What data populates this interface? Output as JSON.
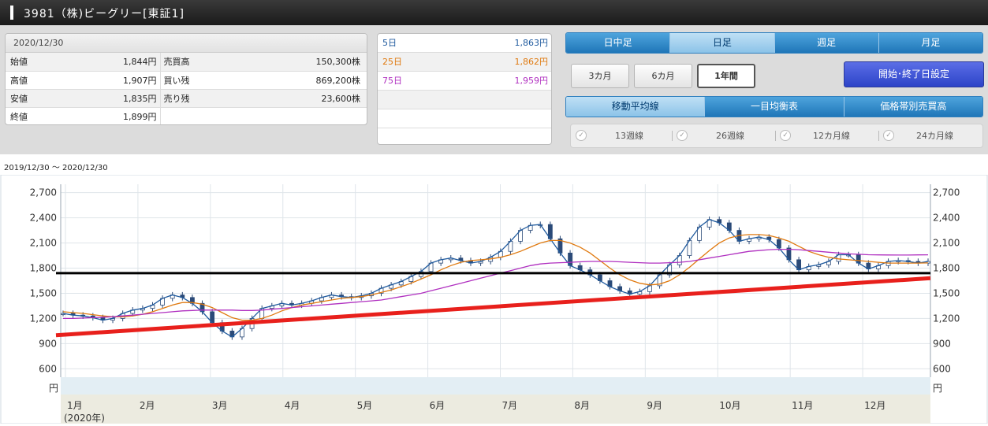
{
  "header": {
    "title": "3981（株)ビーグリー[東証1]"
  },
  "quote": {
    "date": "2020/12/30",
    "rows": [
      {
        "l1": "始値",
        "v1": "1,844円",
        "l2": "売買高",
        "v2": "150,300株"
      },
      {
        "l1": "高値",
        "v1": "1,907円",
        "l2": "買い残",
        "v2": "869,200株"
      },
      {
        "l1": "安値",
        "v1": "1,835円",
        "l2": "売り残",
        "v2": "23,600株"
      },
      {
        "l1": "終値",
        "v1": "1,899円",
        "l2": "",
        "v2": ""
      }
    ]
  },
  "moving_averages": [
    {
      "label": "5日",
      "value": "1,863円",
      "color": "#1f5a9e"
    },
    {
      "label": "25日",
      "value": "1,862円",
      "color": "#e07a10"
    },
    {
      "label": "75日",
      "value": "1,959円",
      "color": "#b030c0"
    }
  ],
  "timeframe_tabs": [
    {
      "label": "日中足",
      "active": false
    },
    {
      "label": "日足",
      "active": true
    },
    {
      "label": "週足",
      "active": false
    },
    {
      "label": "月足",
      "active": false
    }
  ],
  "period_buttons": [
    {
      "label": "3カ月",
      "active": false
    },
    {
      "label": "6カ月",
      "active": false
    },
    {
      "label": "1年間",
      "active": true
    }
  ],
  "range_button": "開始･終了日設定",
  "indicator_tabs": [
    {
      "label": "移動平均線",
      "active": true
    },
    {
      "label": "一目均衡表",
      "active": false
    },
    {
      "label": "価格帯別売買高",
      "active": false
    }
  ],
  "week_options": [
    "13週線",
    "26週線",
    "12カ月線",
    "24カ月線"
  ],
  "period_label": "2019/12/30 ～ 2020/12/30",
  "chart_data": {
    "type": "candlestick",
    "yunit": "円",
    "ylim": [
      500,
      2800
    ],
    "yticks": [
      600,
      900,
      1200,
      1500,
      1800,
      2100,
      2400,
      2700
    ],
    "ytick_labels": [
      "600",
      "900",
      "1,200",
      "1,500",
      "1,800",
      "2,100",
      "2,400",
      "2,700"
    ],
    "x_months": [
      "1月",
      "2月",
      "3月",
      "4月",
      "5月",
      "6月",
      "7月",
      "8月",
      "9月",
      "10月",
      "11月",
      "12月"
    ],
    "x_year_label": "(2020年)",
    "grid": true,
    "series": [
      {
        "name": "5日",
        "color": "#1f5a9e",
        "values": [
          1260,
          1240,
          1230,
          1210,
          1180,
          1200,
          1260,
          1300,
          1320,
          1360,
          1440,
          1480,
          1450,
          1380,
          1280,
          1150,
          1050,
          980,
          1080,
          1200,
          1320,
          1350,
          1380,
          1360,
          1380,
          1410,
          1450,
          1480,
          1460,
          1450,
          1470,
          1500,
          1560,
          1600,
          1640,
          1700,
          1760,
          1860,
          1900,
          1920,
          1890,
          1860,
          1880,
          1930,
          2000,
          2120,
          2250,
          2310,
          2320,
          2150,
          1980,
          1830,
          1780,
          1720,
          1650,
          1580,
          1530,
          1490,
          1520,
          1590,
          1720,
          1840,
          1950,
          2130,
          2290,
          2380,
          2340,
          2250,
          2120,
          2150,
          2170,
          2140,
          2040,
          1900,
          1780,
          1820,
          1840,
          1880,
          1960,
          1960,
          1860,
          1790,
          1830,
          1880,
          1890,
          1880,
          1860,
          1880
        ]
      },
      {
        "name": "25日",
        "color": "#e07a10",
        "values": [
          1280,
          1270,
          1260,
          1245,
          1230,
          1220,
          1220,
          1230,
          1250,
          1280,
          1320,
          1360,
          1390,
          1390,
          1370,
          1330,
          1270,
          1210,
          1180,
          1180,
          1200,
          1240,
          1290,
          1330,
          1360,
          1380,
          1400,
          1420,
          1440,
          1450,
          1460,
          1480,
          1510,
          1540,
          1580,
          1620,
          1670,
          1720,
          1780,
          1830,
          1870,
          1890,
          1900,
          1910,
          1930,
          1960,
          2000,
          2050,
          2100,
          2130,
          2130,
          2100,
          2050,
          1980,
          1890,
          1800,
          1720,
          1660,
          1620,
          1600,
          1610,
          1650,
          1720,
          1810,
          1910,
          2010,
          2100,
          2160,
          2190,
          2200,
          2200,
          2190,
          2160,
          2120,
          2060,
          2000,
          1960,
          1930,
          1910,
          1900,
          1890,
          1880,
          1870,
          1860,
          1860,
          1860,
          1860,
          1862
        ]
      },
      {
        "name": "75日",
        "color": "#b030c0",
        "values": [
          1200,
          1200,
          1205,
          1210,
          1215,
          1220,
          1230,
          1240,
          1250,
          1260,
          1270,
          1280,
          1290,
          1295,
          1300,
          1300,
          1300,
          1300,
          1295,
          1295,
          1300,
          1310,
          1320,
          1330,
          1340,
          1350,
          1360,
          1370,
          1380,
          1390,
          1400,
          1410,
          1420,
          1440,
          1460,
          1480,
          1500,
          1530,
          1560,
          1590,
          1620,
          1650,
          1680,
          1710,
          1740,
          1770,
          1800,
          1830,
          1850,
          1860,
          1865,
          1870,
          1875,
          1880,
          1880,
          1880,
          1875,
          1870,
          1865,
          1860,
          1860,
          1865,
          1870,
          1880,
          1900,
          1920,
          1940,
          1960,
          1980,
          2000,
          2010,
          2020,
          2025,
          2025,
          2020,
          2010,
          2000,
          1990,
          1980,
          1970,
          1965,
          1960,
          1958,
          1957,
          1956,
          1956,
          1958,
          1959
        ]
      }
    ],
    "annotations": [
      {
        "type": "horizontal_line",
        "value": 1740,
        "color": "#000000"
      },
      {
        "type": "trend_line",
        "from": 1000,
        "to": 1680,
        "color": "#e8201c"
      }
    ]
  }
}
